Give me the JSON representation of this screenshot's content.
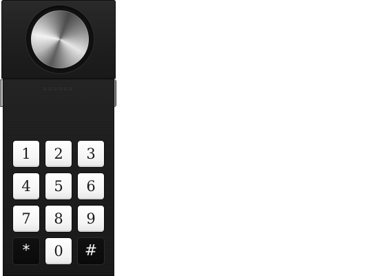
{
  "device": {
    "brand_mark": "▫▫▫▫▫▫"
  },
  "keypad": {
    "keys": [
      {
        "label": "1"
      },
      {
        "label": "2"
      },
      {
        "label": "3"
      },
      {
        "label": "4"
      },
      {
        "label": "5"
      },
      {
        "label": "6"
      },
      {
        "label": "7"
      },
      {
        "label": "8"
      },
      {
        "label": "9"
      },
      {
        "label": "*"
      },
      {
        "label": "0"
      },
      {
        "label": "#"
      }
    ]
  },
  "colors": {
    "panel": "#1c1c1c",
    "key_light": "#ffffff",
    "key_dark": "#0a0a0a",
    "knob_metal": "#c9c9c9"
  }
}
